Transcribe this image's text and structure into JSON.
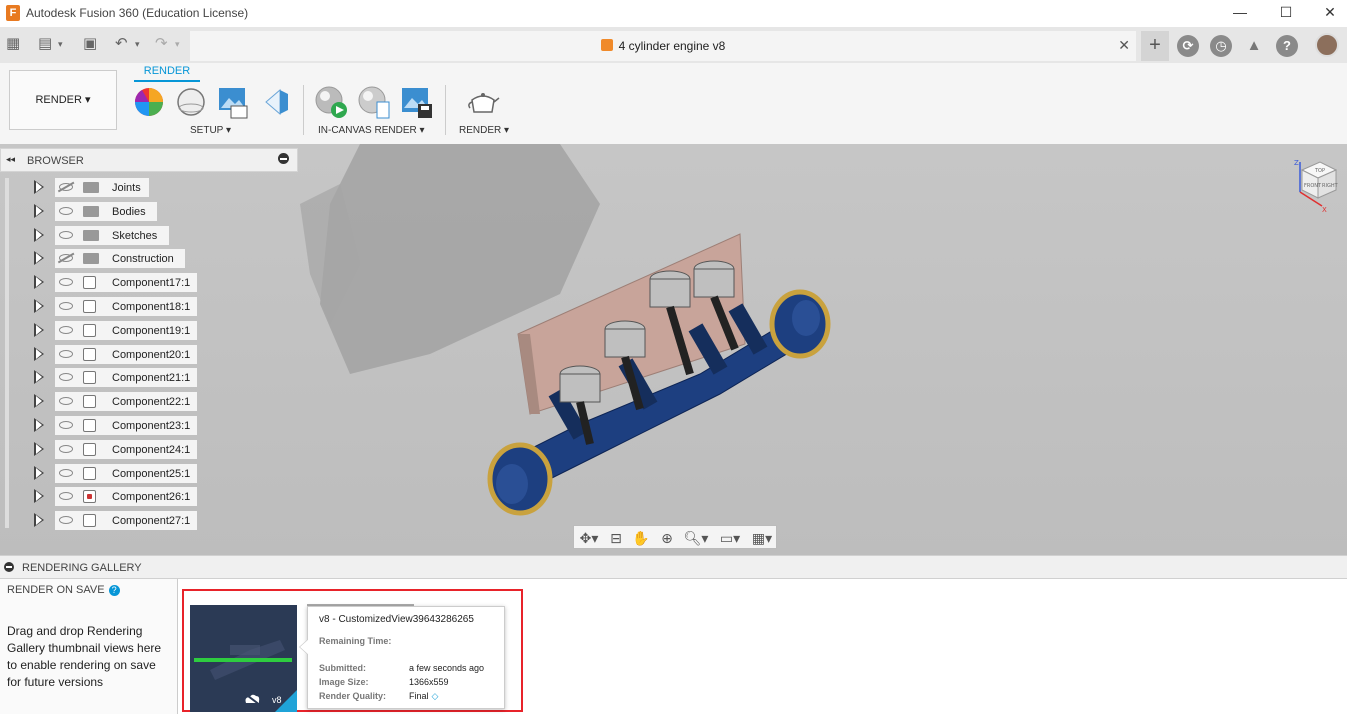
{
  "window": {
    "title": "Autodesk Fusion 360 (Education License)",
    "minimize": "—",
    "maximize": "☐",
    "close": "✕"
  },
  "app_logo": "F",
  "toolbar": {
    "grid_icon": "▦",
    "file_icon": "▤",
    "save_icon": "▣",
    "undo_icon": "↶",
    "redo_icon": "↷",
    "new_tab_icon": "+",
    "jobs_icon": "⟳",
    "history_icon": "◷",
    "notify_icon": "🔔",
    "help_icon": "?"
  },
  "document": {
    "name": "4 cylinder engine v8",
    "close": "✕"
  },
  "ribbon": {
    "workspace": "RENDER ▾",
    "active_tab": "RENDER",
    "groups": [
      {
        "label": "SETUP ▾"
      },
      {
        "label": "IN-CANVAS RENDER ▾"
      },
      {
        "label": "RENDER ▾"
      }
    ]
  },
  "browser": {
    "title": "BROWSER",
    "collapse": "◂◂",
    "minimize": "⊖",
    "items": [
      {
        "label": "Joints",
        "type": "folder",
        "visible": false
      },
      {
        "label": "Bodies",
        "type": "folder",
        "visible": true
      },
      {
        "label": "Sketches",
        "type": "folder",
        "visible": true
      },
      {
        "label": "Construction",
        "type": "folder",
        "visible": false
      },
      {
        "label": "Component17:1",
        "type": "component",
        "visible": true
      },
      {
        "label": "Component18:1",
        "type": "component",
        "visible": true
      },
      {
        "label": "Component19:1",
        "type": "component",
        "visible": true
      },
      {
        "label": "Component20:1",
        "type": "component",
        "visible": true
      },
      {
        "label": "Component21:1",
        "type": "component",
        "visible": true
      },
      {
        "label": "Component22:1",
        "type": "component",
        "visible": true
      },
      {
        "label": "Component23:1",
        "type": "component",
        "visible": true
      },
      {
        "label": "Component24:1",
        "type": "component",
        "visible": true
      },
      {
        "label": "Component25:1",
        "type": "component",
        "visible": true
      },
      {
        "label": "Component26:1",
        "type": "component",
        "visible": true,
        "error": true
      },
      {
        "label": "Component27:1",
        "type": "component",
        "visible": true
      }
    ]
  },
  "viewcube": {
    "top": "TOP",
    "front": "FRONT",
    "right": "RIGHT",
    "axis_x": "X",
    "axis_z": "Z"
  },
  "navbar": {
    "orbit": "✥▾",
    "look": "⊟",
    "pan": "✋",
    "zoom": "⊕",
    "fit": "🔍︎▾",
    "display": "▭▾",
    "grid": "▦▾"
  },
  "gallery": {
    "title": "RENDERING GALLERY",
    "render_on_save": "RENDER ON SAVE",
    "help": "?",
    "drag_drop_text": "Drag and drop Rendering Gallery thumbnail views here to enable rendering on save for future versions",
    "thumbnail": {
      "version": "v8",
      "progress": 1.0
    },
    "popup": {
      "title": "v8 - CustomizedView39643286265",
      "remaining_time_label": "Remaining Time:",
      "submitted_label": "Submitted:",
      "submitted_value": "a few seconds ago",
      "image_size_label": "Image Size:",
      "image_size_value": "1366x559",
      "quality_label": "Render Quality:",
      "quality_value": "Final"
    }
  },
  "colors": {
    "accent": "#0696d7",
    "highlight_border": "#e8232a",
    "progress": "#2ecc40",
    "engine_block": "#c8a49a",
    "crank_blue": "#1d3f80"
  }
}
